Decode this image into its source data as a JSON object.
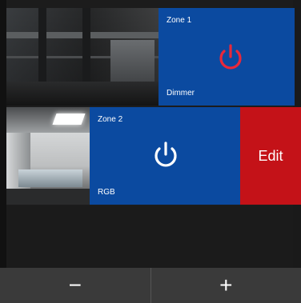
{
  "zones": [
    {
      "name": "Zone 1",
      "type": "Dimmer",
      "power_color": "#e8283a",
      "tile_color": "#0b4aa0"
    },
    {
      "name": "Zone 2",
      "type": "RGB",
      "power_color": "#ffffff",
      "tile_color": "#0b4aa0"
    }
  ],
  "swipe_action": {
    "label": "Edit",
    "color": "#c41218"
  },
  "bottom_bar": {
    "minus_label": "−",
    "plus_label": "+"
  }
}
